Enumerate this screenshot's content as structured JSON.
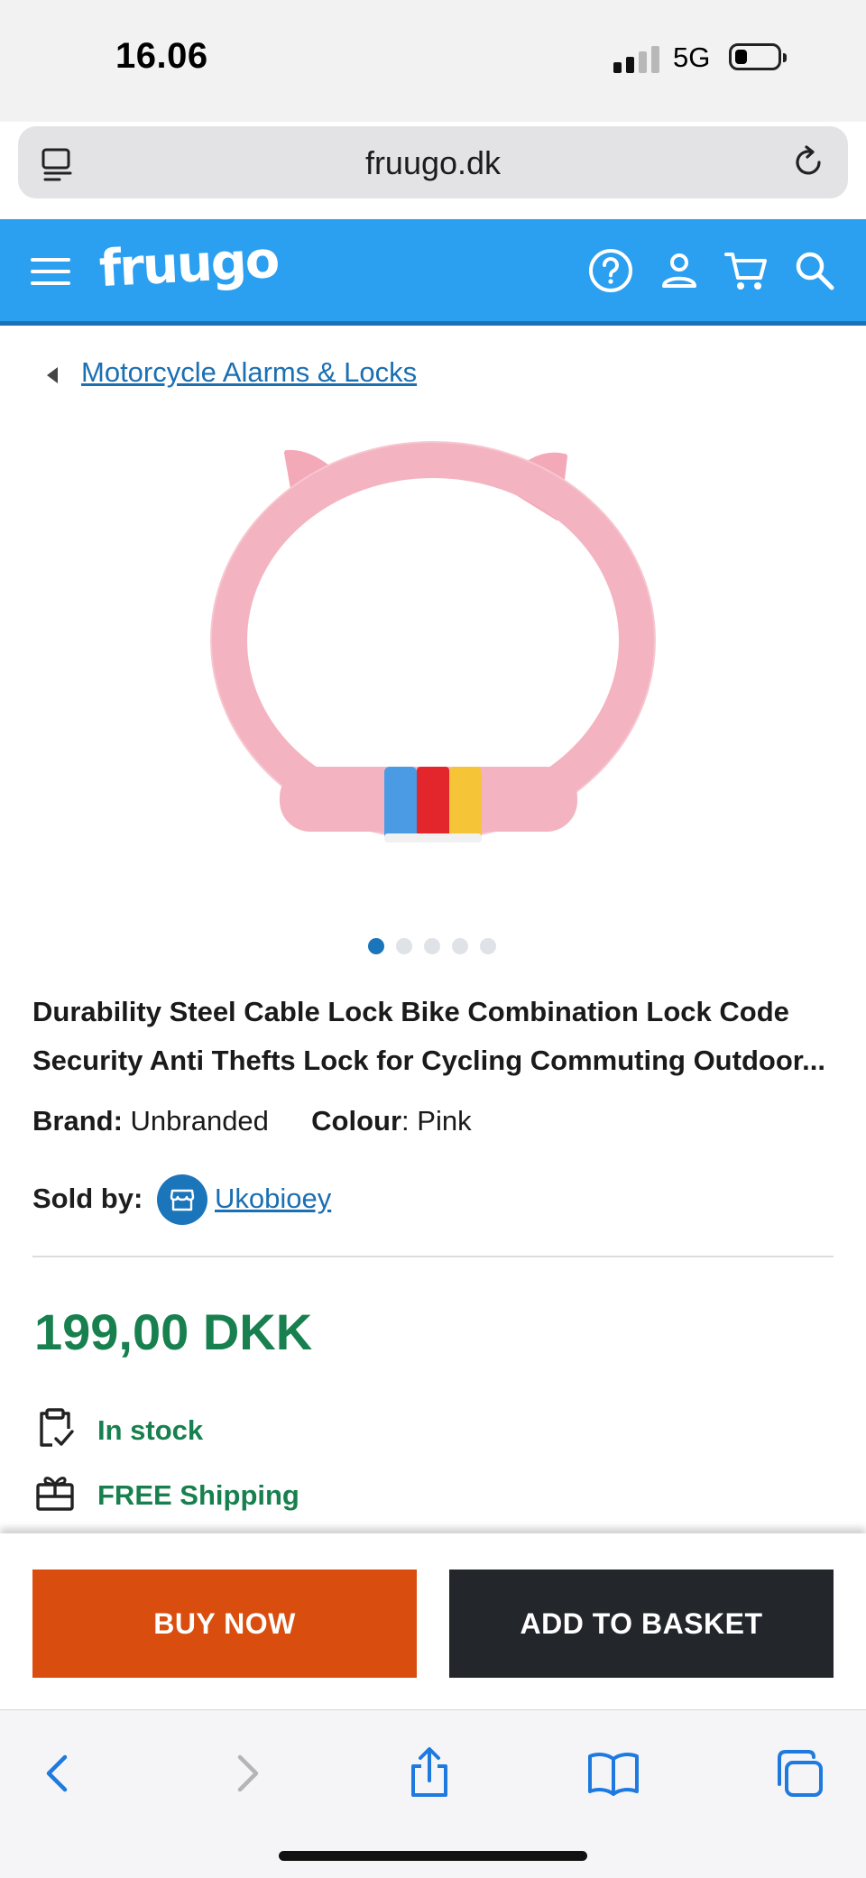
{
  "status_bar": {
    "time": "16.06",
    "network": "5G"
  },
  "browser": {
    "url": "fruugo.dk"
  },
  "header": {
    "logo": "fruugo"
  },
  "breadcrumb": {
    "label": "Motorcycle Alarms & Locks"
  },
  "product": {
    "title": "Durability Steel Cable Lock Bike Combination Lock Code Security Anti Thefts Lock for Cycling Commuting Outdoor...",
    "brand_label": "Brand:",
    "brand_value": "Unbranded",
    "colour_label": "Colour",
    "colour_value": "Pink",
    "sold_by_label": "Sold by:",
    "seller": "Ukobioey",
    "price": "199,00 DKK",
    "stock": "In stock",
    "shipping": "FREE Shipping",
    "image_count": 5,
    "active_image": 1
  },
  "actions": {
    "buy_now": "BUY NOW",
    "add_to_basket": "ADD TO BASKET"
  },
  "colors": {
    "header_blue": "#2b9ff0",
    "link_blue": "#1b6fb3",
    "price_green": "#17804e",
    "buy_orange": "#d94e0e",
    "basket_dark": "#23272b",
    "product_pink": "#f4b3c0"
  },
  "icons": {
    "header": [
      "menu-icon",
      "help-icon",
      "account-icon",
      "cart-icon",
      "search-icon"
    ],
    "toolbar": [
      "back-icon",
      "forward-icon",
      "share-icon",
      "bookmarks-icon",
      "tabs-icon"
    ]
  }
}
